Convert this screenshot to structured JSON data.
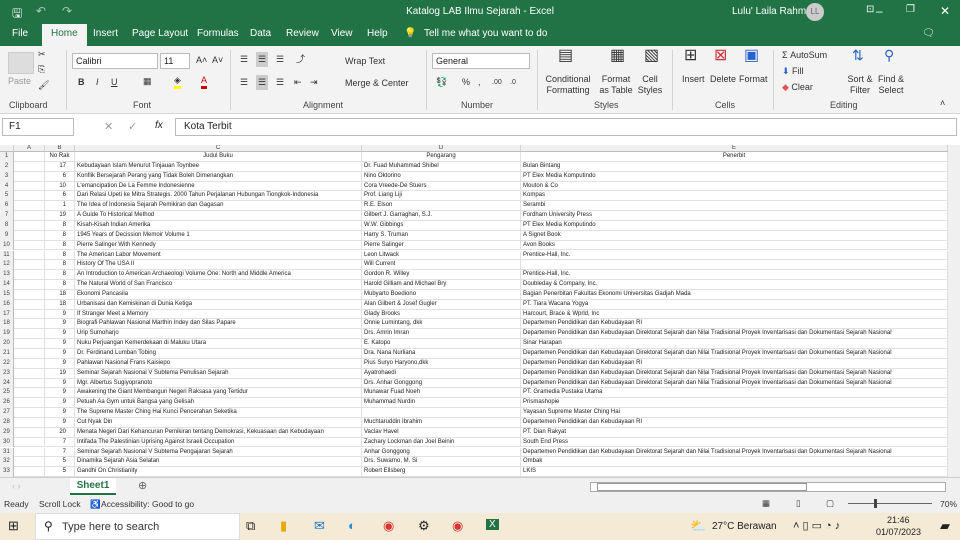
{
  "title_bar": {
    "title": "Katalog LAB Ilmu Sejarah  -  Excel",
    "user": "Lulu' Laila Rahma",
    "initials": "LL"
  },
  "tabs": [
    "File",
    "Home",
    "Insert",
    "Page Layout",
    "Formulas",
    "Data",
    "Review",
    "View",
    "Help"
  ],
  "tell_me": "Tell me what you want to do",
  "ribbon": {
    "paste": "Paste",
    "font_name": "Calibri",
    "font_size": "11",
    "bold": "B",
    "italic": "I",
    "underline": "U",
    "wrap_text": "Wrap Text",
    "merge_center": "Merge & Center",
    "number_format": "General",
    "percent": "%",
    "comma": ",",
    "cond_fmt": "Conditional Formatting",
    "fmt_table": "Format as Table",
    "cell_styles": "Cell Styles",
    "insert": "Insert",
    "delete": "Delete",
    "format": "Format",
    "autosum": "AutoSum",
    "fill": "Fill",
    "clear": "Clear",
    "sort_filter": "Sort & Filter",
    "find_select": "Find & Select",
    "groups": {
      "clipboard": "Clipboard",
      "font": "Font",
      "alignment": "Alignment",
      "number": "Number",
      "styles": "Styles",
      "cells": "Cells",
      "editing": "Editing"
    }
  },
  "formula_bar": {
    "name_box": "F1",
    "fx": "fx",
    "value": "Kota Terbit"
  },
  "columns": [
    "A",
    "B",
    "C",
    "D",
    "E"
  ],
  "headers": [
    "",
    "No Rak",
    "Judul Buku",
    "Pengarang",
    "Penerbit"
  ],
  "rows": [
    [
      "17",
      "Kebudayaan Islam Menurut Tinjauan Toynbee",
      "Dr. Fuad Muhammad Shibel",
      "Bulan Bintang"
    ],
    [
      "6",
      "Konflik Bersejarah Perang yang Tidak Boleh Dimenangkan",
      "Nino Oktorino",
      "PT Elex Media Komputindo"
    ],
    [
      "10",
      "L'emancipation De La Femme Indonesienne",
      "Cora Vreede-De Stuers",
      "Mouton & Co"
    ],
    [
      "6",
      "Dari Relasi Upeti ke Mitra Strategis. 2000 Tahun Perjalanan Hubungan Tiongkok-Indonesia",
      "Prof. Liang Liji",
      "Kompas"
    ],
    [
      "1",
      "The Idea of Indonesia Sejarah Pemikiran dan Gagasan",
      "R.E. Elson",
      "Serambi"
    ],
    [
      "19",
      "A Guide To Historical Method",
      "Gilbert J. Garraghan, S.J.",
      "Fordham University Press"
    ],
    [
      "8",
      "Kisah-Kisah Indian Amerika",
      "W.W. Gibbings",
      "PT Elex Media Komputindo"
    ],
    [
      "8",
      "1945 Years of Decission Memoir  Volume 1",
      "Harry S. Truman",
      "A Signet Book"
    ],
    [
      "8",
      "Pierre Salinger With Kennedy",
      "Pierre Salinger",
      "Avon Books"
    ],
    [
      "8",
      "The American Labor Movement",
      "Leon Litwack",
      "Prentice-Hall, Inc."
    ],
    [
      "8",
      "History Of The USA II",
      "Will Current",
      ""
    ],
    [
      "8",
      "An Introduction to American Archaeologi Volume One: North and Middle America",
      "Gordon R. Willey",
      "Prentice-Hall, Inc."
    ],
    [
      "8",
      "The Natural World of San Francisco",
      "Harold Gilliam and Michael Bry",
      "Doubleday & Company, Inc."
    ],
    [
      "18",
      "Ekonomi Pancasila",
      "Mubyarto Boediono",
      "Bagian Penerbitan Fakultas Ekonomi Universitas Gadjah Mada"
    ],
    [
      "18",
      "Urbanisasi dan Kemiskinan di Dunia Ketiga",
      "Alan Gilbert & Josef Gugler",
      "PT. Tiara Wacana Yogya"
    ],
    [
      "9",
      "If Stranger Meet a Memory",
      "Glady Brooks",
      "Harcourt, Brace & Wprld, Inc"
    ],
    [
      "9",
      "Biografi Pahlawan Nasional Marthin Indey dan Silas Papare",
      "Onnie Lumintang, dkk",
      "Departemen Pendidikan dan Kebudayaan RI"
    ],
    [
      "9",
      "Urip Sumoharjo",
      "Drs. Amrin Imran",
      "Departemen Pendidikan dan Kebudayaan Direktorat Sejarah  dan Nilai Tradisional Proyek Inventarisasi dan Dokumentasi Sejarah Nasional"
    ],
    [
      "9",
      "Nuku Perjuangan Kemerdekaan di Maluku Utara",
      "E. Katopo",
      "Sinar Harapan"
    ],
    [
      "9",
      "Dr. Ferdinand Lumban Tobing",
      "Dra. Nana Nurliana",
      "Departemen Pendidikan dan Kebudayaan Direktorat Sejarah  dan Nilai Tradisional Proyek Inventarisasi dan Dokumentasi Sejarah Nasional"
    ],
    [
      "9",
      "Pahlawan Nasional Frans Kaisiepo",
      "Pius Suryo Haryono,dkk",
      "Departemen Pendidikan dan Kebudayaan RI"
    ],
    [
      "19",
      "Seminar Sejarah Nasional V Subtema Penulisan Sejarah",
      "Ayatrohaedi",
      "Departemen Pendidikan dan Kebudayaan Direktorat Sejarah  dan Nilai Tradisional Proyek Inventarisasi dan Dokumentasi Sejarah Nasional"
    ],
    [
      "9",
      "Mgr. Albertus Sugiyopranoto",
      "Drs. Anhar Gonggong",
      "Departemen Pendidikan dan Kebudayaan Direktorat Sejarah  dan Nilai Tradisional Proyek Inventarisasi dan Dokumentasi Sejarah Nasional"
    ],
    [
      "9",
      "Awakening the Giant Membangun Negeri Raksasa yang Tertidur",
      "Munawar Fuad Noeh",
      "PT. Gramedia Pustaka Utama"
    ],
    [
      "9",
      "Petuah Aa Gym untuk Bangsa yang Gelisah",
      "Muhammad Nurdin",
      "Prismashopie"
    ],
    [
      "9",
      "The Supreme Master Ching Hai Kunci Pencerahan Seketika",
      "",
      "Yayasan Supreme Master Ching Hai"
    ],
    [
      "9",
      "Cut Nyak Din",
      "Muchtaruddin Ibrahim",
      "Departemen Pendidikan dan Kebudayaan RI"
    ],
    [
      "20",
      "Menata Negeri Dari Kehancuran Pemikiran tentang Demokrasi, Kekuasaan dan Kebudayaan",
      "Vaclav Havel",
      "PT. Dian Rakyat"
    ],
    [
      "7",
      "Intifada The Palestinian Uprising Against Israeli Occupation",
      "Zachary Lockman dan Joel Beinin",
      "South End Press"
    ],
    [
      "7",
      "Seminar Sejarah Nasional V Subtema Pengajaran Sejarah",
      "Anhar Gonggong",
      "Departemen Pendidikan dan Kebudayaan Direktorat Sejarah  dan Nilai Tradisional Proyek Inventarisasi dan Dokumentasi Sejarah Nasional"
    ],
    [
      "5",
      "Dinamika Sejarah Asia Selatan",
      "Drs. Suwarno, M. Si",
      "Ombak"
    ],
    [
      "5",
      "Gandhi On Christianity",
      "Robert Ellsberg",
      "LKIS"
    ]
  ],
  "sheet_tab": "Sheet1",
  "status": {
    "ready": "Ready",
    "scroll_lock": "Scroll Lock",
    "accessibility": "Accessibility: Good to go",
    "zoom": "70%"
  },
  "taskbar": {
    "search": "Type here to search",
    "weather": "27°C  Berawan",
    "time": "21:46",
    "date": "01/07/2023"
  }
}
